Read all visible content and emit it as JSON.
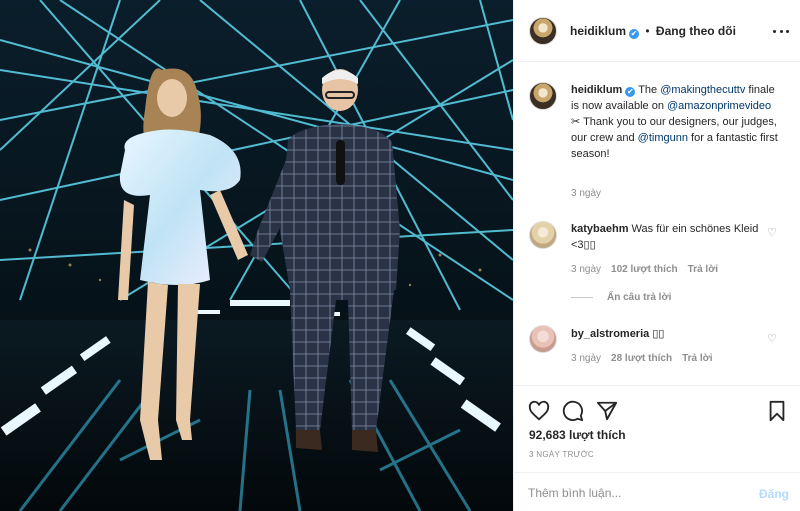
{
  "post_author": {
    "username": "heidiklum",
    "verified_mark": "✔",
    "separator": "•",
    "follow_status": "Đang theo dõi"
  },
  "caption": {
    "username": "heidiklum",
    "text_1": "The ",
    "mention_1": "@makingthecuttv",
    "text_2": " finale is now available on ",
    "mention_2": "@amazonprimevideo",
    "text_3": " ✂ Thank you to our designers, our judges, our crew and ",
    "mention_3": "@timgunn",
    "text_4": " for a fantastic first season!",
    "time": "3 ngày"
  },
  "comments": [
    {
      "username": "katybaehm",
      "text": "Was für ein schönes Kleid <3▯▯",
      "time": "3 ngày",
      "likes": "102 lượt thích",
      "reply_label": "Trả lời",
      "hidden_replies": "Ẩn câu trả lời"
    },
    {
      "username": "by_alstromeria",
      "text": "▯▯",
      "time": "3 ngày",
      "likes": "28 lượt thích",
      "reply_label": "Trả lời"
    }
  ],
  "actions": {
    "like_count": "92,683 lượt thích",
    "time_ago": "3 NGÀY TRƯỚC"
  },
  "add_comment": {
    "placeholder": "Thêm bình luận...",
    "post_label": "Đăng"
  },
  "colors": {
    "link": "#00376b",
    "verified": "#3897f0",
    "muted": "#8e8e8e",
    "post_disabled": "#b3dbff"
  },
  "icons": [
    "more-horizontal-icon",
    "heart-icon",
    "comment-icon",
    "share-icon",
    "bookmark-icon",
    "verified-badge-icon"
  ]
}
